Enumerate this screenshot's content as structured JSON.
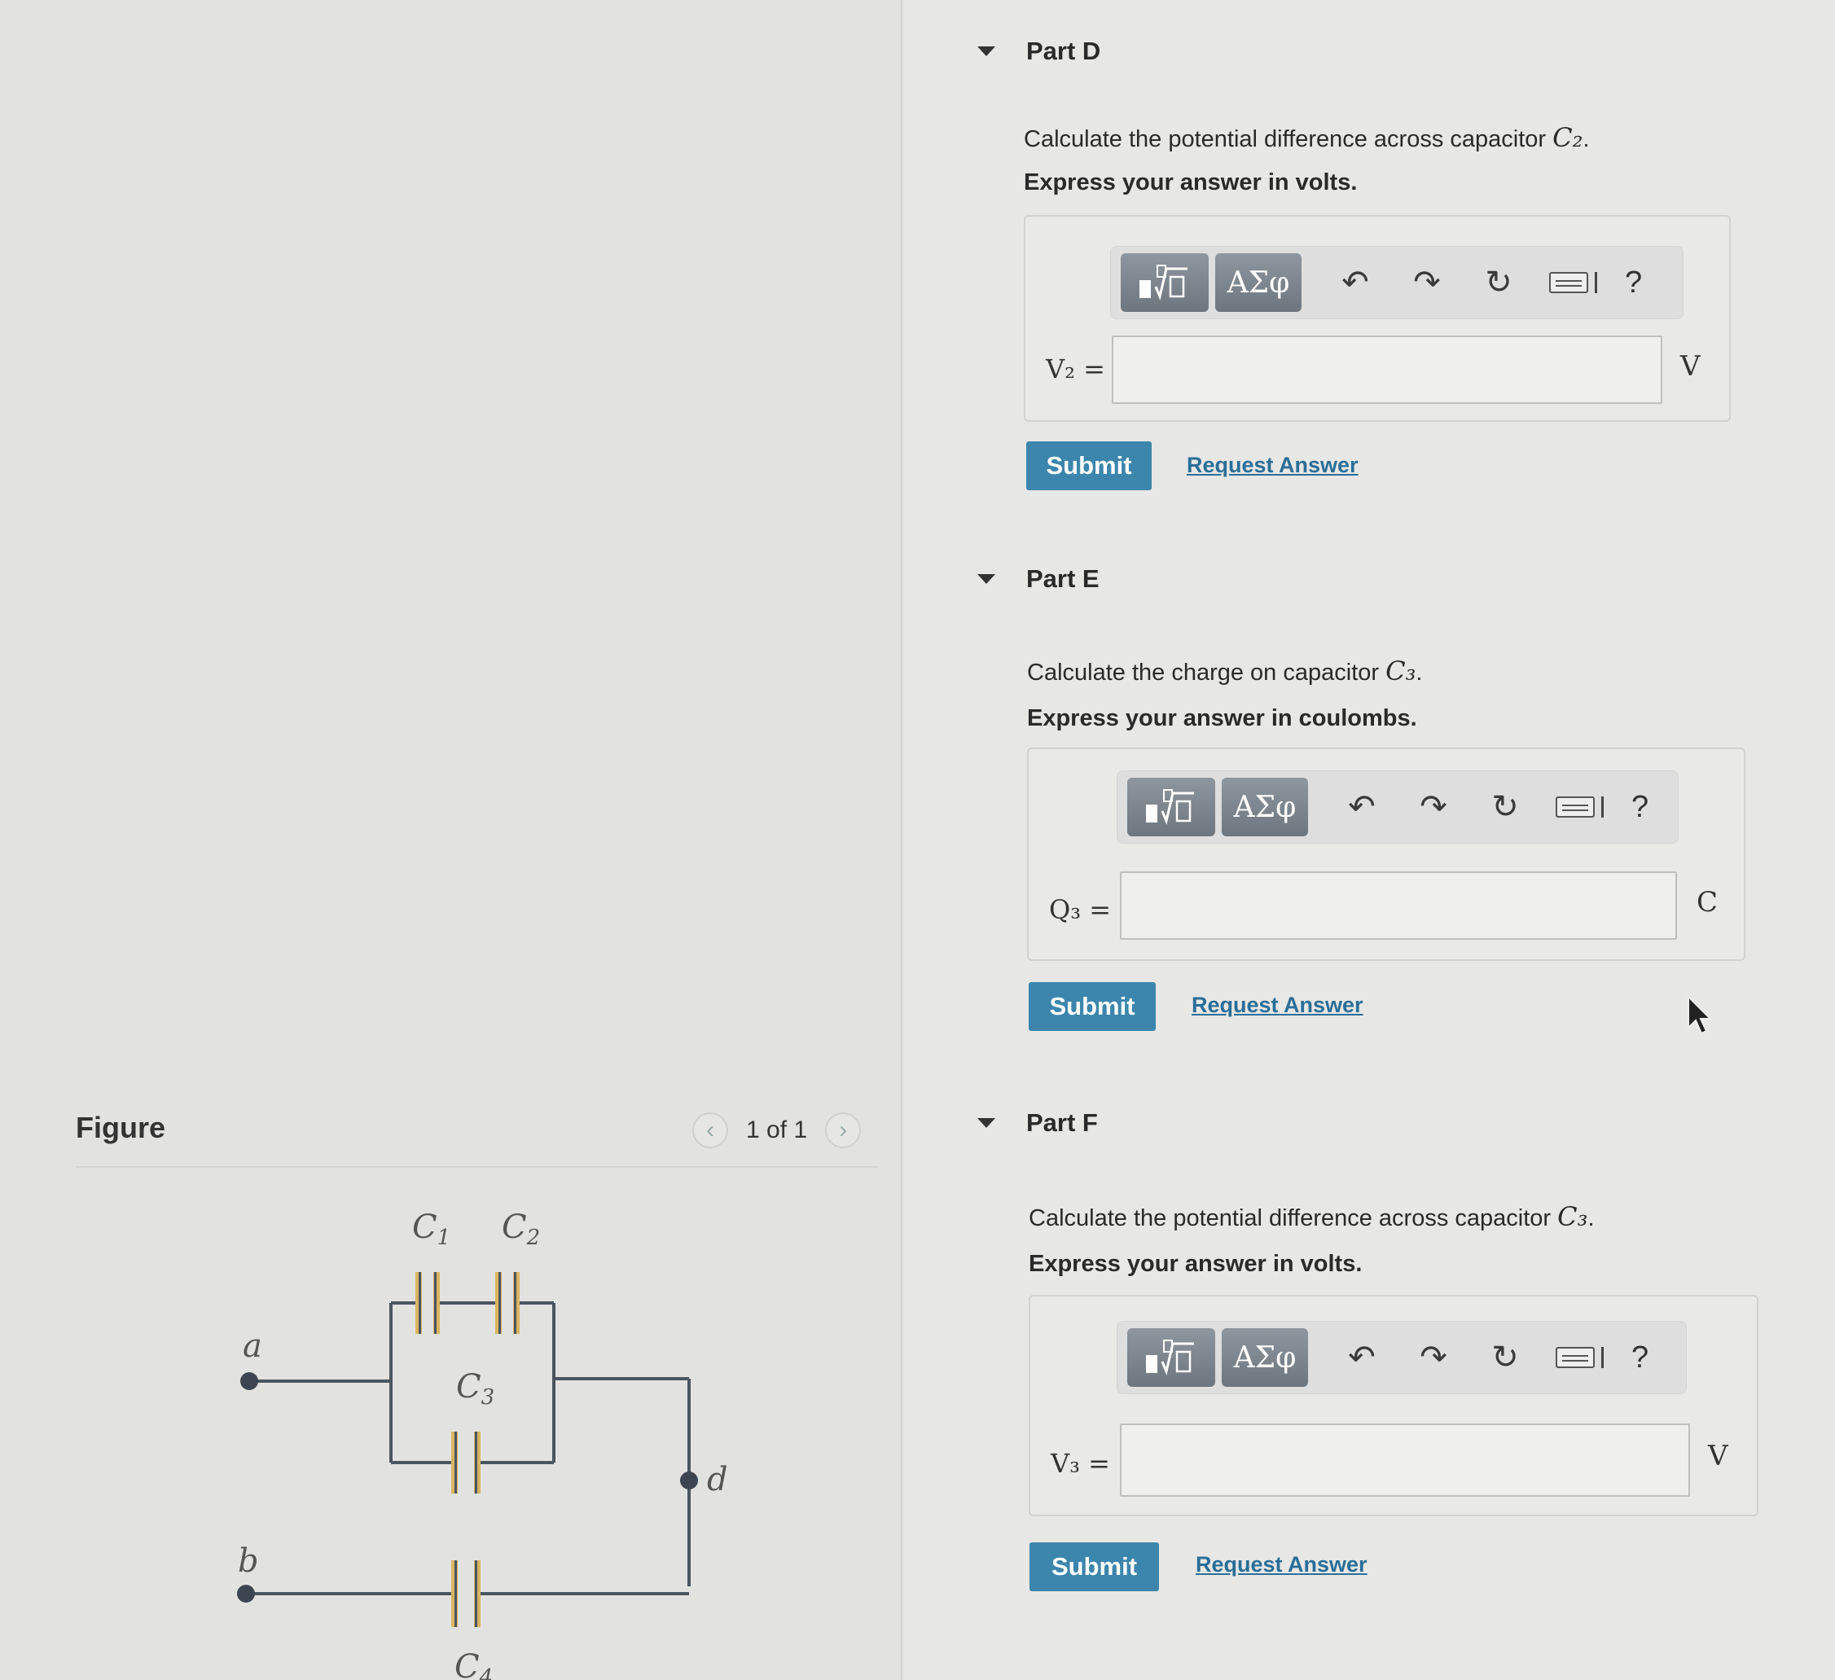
{
  "figure": {
    "title": "Figure",
    "counter": "1 of 1",
    "prev_icon": "chevron-left-icon",
    "next_icon": "chevron-right-icon",
    "circuit_labels": {
      "c1": "C1",
      "c2": "C2",
      "c3": "C3",
      "c4": "C4",
      "a": "a",
      "b": "b",
      "d": "d"
    }
  },
  "parts": [
    {
      "title": "Part D",
      "question_prefix": "Calculate the potential difference across capacitor ",
      "question_math": "C₂",
      "question_suffix": ".",
      "express": "Express your answer in volts.",
      "variable": "V₂ =",
      "input_value": "",
      "unit": "V",
      "submit": "Submit",
      "request": "Request Answer"
    },
    {
      "title": "Part E",
      "question_prefix": "Calculate the charge on capacitor ",
      "question_math": "C₃",
      "question_suffix": ".",
      "express": "Express your answer in coulombs.",
      "variable": "Q₃ =",
      "input_value": "",
      "unit": "C",
      "submit": "Submit",
      "request": "Request Answer"
    },
    {
      "title": "Part F",
      "question_prefix": "Calculate the potential difference across capacitor ",
      "question_math": "C₃",
      "question_suffix": ".",
      "express": "Express your answer in volts.",
      "variable": "V₃ =",
      "input_value": "",
      "unit": "V",
      "submit": "Submit",
      "request": "Request Answer"
    }
  ],
  "toolbar": {
    "greek_label": "ΑΣφ",
    "help_label": "?",
    "icons": [
      "templates-icon",
      "greek-icon",
      "undo-icon",
      "redo-icon",
      "reset-icon",
      "keyboard-icon",
      "help-icon"
    ]
  },
  "colors": {
    "submit": "#3c86ad",
    "link": "#2a6e98",
    "capacitor_plate": "#d9b560"
  }
}
